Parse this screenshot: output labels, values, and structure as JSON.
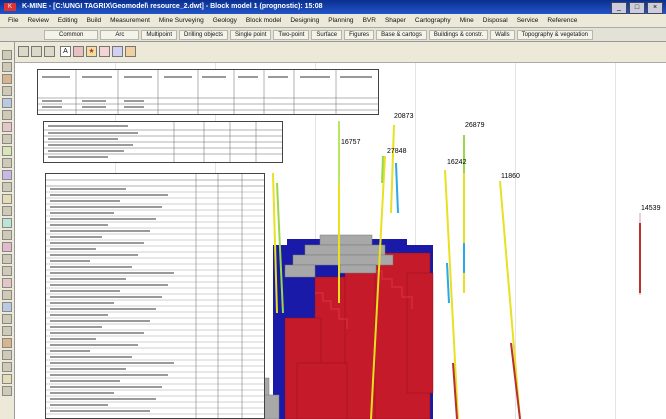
{
  "window": {
    "title": "K-MINE - [C:\\UNGI TAGRIX\\Geomodel\\ resource_2.dwt] - Block model 1 (prognostic): 15:08",
    "buttons": [
      "_",
      "□",
      "×"
    ]
  },
  "menu": [
    "File",
    "Review",
    "Editing",
    "Build",
    "Measurement",
    "Mine Surveying",
    "Geology",
    "Block model",
    "Designing",
    "Planning",
    "BVR",
    "Shaper",
    "Cartography",
    "Mine",
    "Disposal",
    "Service",
    "Reference"
  ],
  "tabs": [
    "Common",
    "Arc",
    "Multipoint",
    "Drilling objects",
    "Single point",
    "Two-point",
    "Surface",
    "Figures",
    "Base & cartogs",
    "Buildings & constr.",
    "Walls",
    "Topography & vegetation"
  ],
  "well_labels": [
    "16757",
    "20873",
    "27848",
    "26879",
    "16242",
    "11860",
    "14539"
  ],
  "colors": {
    "blocks_red": "#c41a2a",
    "blocks_blue": "#1a1aa8",
    "blocks_grey": "#a8a8a8",
    "trace_yellow": "#e8e020",
    "trace_blue": "#2aa8e8",
    "trace_red": "#b83030",
    "accent_titlebar": "#0a2f8f"
  }
}
